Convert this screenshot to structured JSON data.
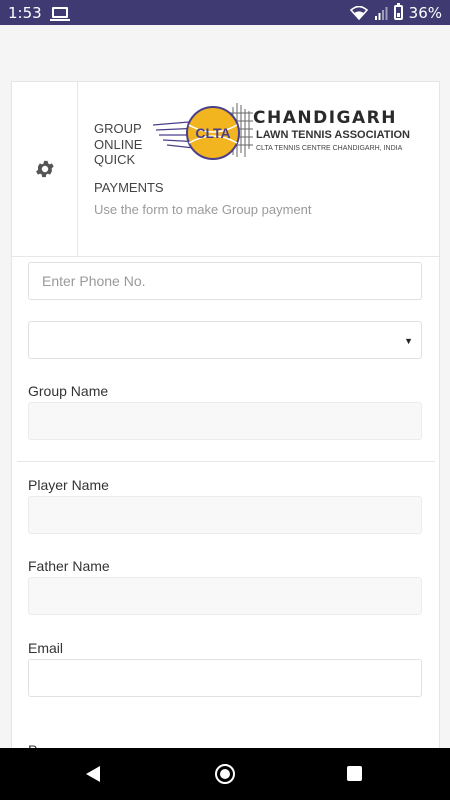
{
  "status_bar": {
    "time": "1:53",
    "battery": "36%"
  },
  "header": {
    "title": "GROUP ONLINE QUICK",
    "subtitle": "PAYMENTS",
    "help": "Use the form to make Group payment",
    "logo": {
      "badge": "CLTA",
      "name": "CHANDIGARH",
      "association": "LAWN TENNIS ASSOCIATION",
      "tagline": "CLTA TENNIS CENTRE CHANDIGARH, INDIA"
    }
  },
  "form": {
    "phone_placeholder": "Enter Phone No.",
    "select_value": "",
    "group_name_label": "Group Name",
    "player_name_label": "Player Name",
    "father_name_label": "Father Name",
    "email_label": "Email",
    "next_label": "P"
  },
  "colors": {
    "status_bar": "#3f3a72",
    "logo_purple": "#4b3f8a",
    "ball": "#f2b51f"
  }
}
